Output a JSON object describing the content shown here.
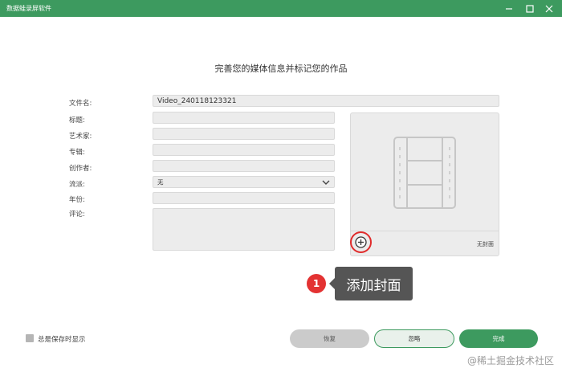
{
  "window": {
    "title": "数据蛙录屏软件",
    "controls": [
      "minimize-icon",
      "maximize-icon",
      "close-icon"
    ],
    "titlebar_color": "#3d9a5f"
  },
  "heading": "完善您的媒体信息并标记您的作品",
  "form": {
    "filename_label": "文件名:",
    "filename_value": "Video_240118123321",
    "title_label": "标题:",
    "title_value": "",
    "artist_label": "艺术家:",
    "artist_value": "",
    "album_label": "专辑:",
    "album_value": "",
    "creator_label": "创作者:",
    "creator_value": "",
    "genre_label": "流派:",
    "genre_value": "无",
    "year_label": "年份:",
    "year_value": "",
    "comment_label": "评论:",
    "comment_value": ""
  },
  "cover": {
    "no_cover_label": "无封面",
    "placeholder_icon": "film-strip-icon",
    "add_icon": "add-circle-icon"
  },
  "callout": {
    "step_number": "1",
    "text": "添加封面",
    "highlight_color": "#e02b2b"
  },
  "footer": {
    "checkbox_label": "总是保存时显示",
    "restore_button": "恢复",
    "ignore_button": "忽略",
    "done_button": "完成"
  },
  "watermark": "@稀土掘金技术社区"
}
